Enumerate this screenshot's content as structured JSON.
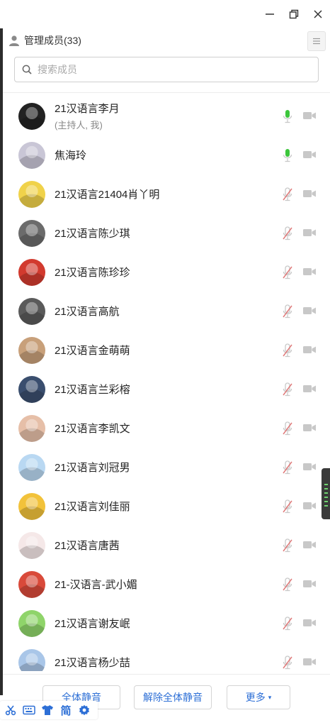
{
  "header": {
    "title": "管理成员(33)"
  },
  "search": {
    "placeholder": "搜索成员",
    "value": ""
  },
  "members": [
    {
      "name": "21汉语言李月",
      "subtitle": "(主持人, 我)",
      "mic": "on"
    },
    {
      "name": "焦海玲",
      "subtitle": "",
      "mic": "on"
    },
    {
      "name": "21汉语言21404肖丫明",
      "subtitle": "",
      "mic": "muted"
    },
    {
      "name": "21汉语言陈少琪",
      "subtitle": "",
      "mic": "muted"
    },
    {
      "name": "21汉语言陈珍珍",
      "subtitle": "",
      "mic": "muted"
    },
    {
      "name": "21汉语言高航",
      "subtitle": "",
      "mic": "muted"
    },
    {
      "name": "21汉语言金萌萌",
      "subtitle": "",
      "mic": "muted"
    },
    {
      "name": "21汉语言兰彩榕",
      "subtitle": "",
      "mic": "muted"
    },
    {
      "name": "21汉语言李凯文",
      "subtitle": "",
      "mic": "muted"
    },
    {
      "name": "21汉语言刘冠男",
      "subtitle": "",
      "mic": "muted"
    },
    {
      "name": "21汉语言刘佳丽",
      "subtitle": "",
      "mic": "muted"
    },
    {
      "name": "21汉语言唐茜",
      "subtitle": "",
      "mic": "muted"
    },
    {
      "name": "21-汉语言-武小媚",
      "subtitle": "",
      "mic": "muted"
    },
    {
      "name": "21汉语言谢友岷",
      "subtitle": "",
      "mic": "muted"
    },
    {
      "name": "21汉语言杨少喆",
      "subtitle": "",
      "mic": "muted"
    }
  ],
  "footer": {
    "mute_all_label": "全体静音",
    "unmute_all_label": "解除全体静音",
    "more_label": "更多",
    "more_caret": "▾"
  },
  "ime_toolbar": {
    "simplified_label": "简"
  },
  "colors": {
    "accent": "#2d6fd6",
    "mic_on": "#3cc63c",
    "mic_muted": "#e07a7a",
    "icon_gray": "#c8c8c8",
    "avatars": [
      "#222222",
      "#c9c6d6",
      "#f0d24a",
      "#6b6b6b",
      "#d23a2e",
      "#5a5a5a",
      "#c8a07a",
      "#3a4e6e",
      "#e6bfa8",
      "#b9d8f2",
      "#f2c23a",
      "#f5e8e8",
      "#d94a3a",
      "#8fd46a",
      "#a9c6e8"
    ]
  }
}
